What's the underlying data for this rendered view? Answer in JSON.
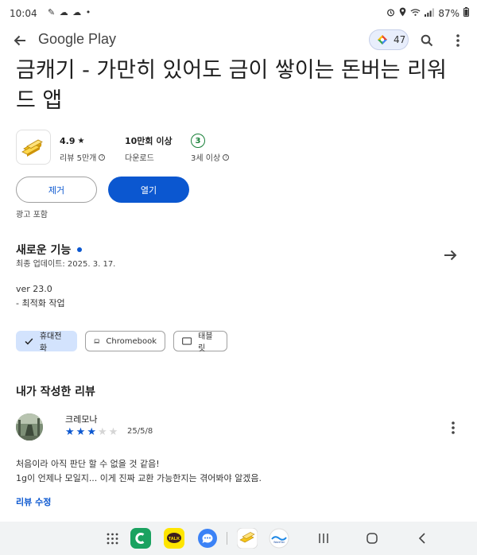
{
  "status_bar": {
    "time": "10:04",
    "left_icons": "✎ ☁ ☁ •",
    "battery": "87%"
  },
  "app_bar": {
    "title": "Google Play",
    "rewards_points": "47"
  },
  "app": {
    "name": "금캐기 - 가만히 있어도 금이 쌓이는 돈버는 리워드 앱",
    "rating": "4.9",
    "reviews_label": "리뷰 5만개",
    "downloads": "10만회 이상",
    "downloads_label": "다운로드",
    "age_rating": "3",
    "age_label": "3세 이상"
  },
  "actions": {
    "uninstall": "제거",
    "open": "열기",
    "ads_note": "광고 포함"
  },
  "whats_new": {
    "title": "새로운 기능",
    "updated": "최종 업데이트: 2025. 3. 17.",
    "version": "ver 23.0",
    "change": "- 최적화 작업"
  },
  "device_chips": [
    {
      "label": "휴대전화",
      "selected": true
    },
    {
      "label": "Chromebook",
      "selected": false
    },
    {
      "label": "태블릿",
      "selected": false
    }
  ],
  "my_review": {
    "title": "내가 작성한 리뷰",
    "reviewer": "크레모나",
    "stars": 3,
    "max_stars": 5,
    "date": "25/5/8",
    "line1": "처음이라 아직 판단 할 수 없을 것 같음!",
    "line2": "1g이 언제나 모일지... 이게 진짜 교환 가능한지는 겪어봐야 알겠음.",
    "edit_label": "리뷰 수정"
  },
  "nav_bar": {
    "kakao_label": "TALK",
    "app_label": "WaveTax"
  },
  "colors": {
    "accent": "#0b57d0",
    "chip_selected": "#d3e3fd",
    "age_green": "#188038"
  }
}
